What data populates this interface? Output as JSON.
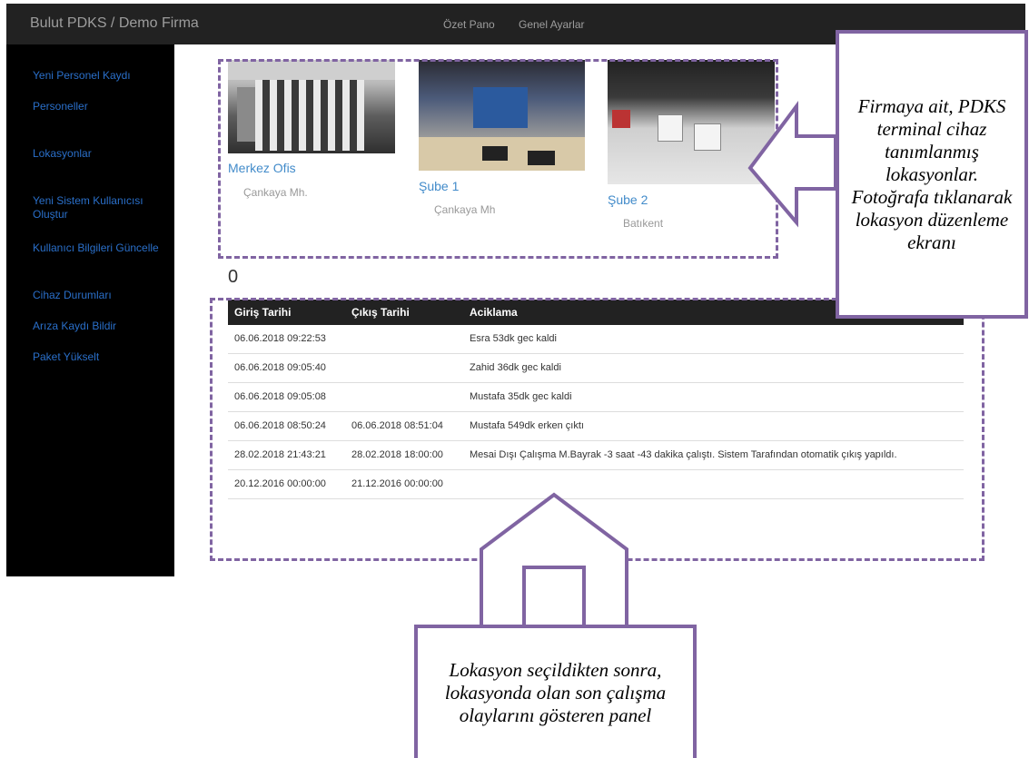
{
  "navbar": {
    "brand": "Bulut PDKS / Demo Firma",
    "links": [
      "Özet Pano",
      "Genel Ayarlar"
    ]
  },
  "sidebar": {
    "items": [
      {
        "label": "Yeni Personel Kaydı"
      },
      {
        "label": "Personeller"
      },
      {
        "label": "Lokasyonlar"
      },
      {
        "label": "Yeni Sistem Kullanıcısı Oluştur"
      },
      {
        "label": "Kullanıcı Bilgileri Güncelle"
      },
      {
        "label": "Cihaz Durumları"
      },
      {
        "label": "Arıza Kaydı Bildir"
      },
      {
        "label": "Paket Yükselt"
      }
    ]
  },
  "locations": [
    {
      "title": "Merkez Ofis",
      "address": "Çankaya Mh."
    },
    {
      "title": "Şube 1",
      "address": "Çankaya Mh"
    },
    {
      "title": "Şube 2",
      "address": "Batıkent"
    }
  ],
  "count": "0",
  "table": {
    "headers": [
      "Giriş Tarihi",
      "Çıkış Tarihi",
      "Aciklama"
    ],
    "rows": [
      [
        "06.06.2018 09:22:53",
        "",
        "Esra 53dk gec kaldi"
      ],
      [
        "06.06.2018 09:05:40",
        "",
        "Zahid 36dk gec kaldi"
      ],
      [
        "06.06.2018 09:05:08",
        "",
        "Mustafa 35dk gec kaldi"
      ],
      [
        "06.06.2018 08:50:24",
        "06.06.2018 08:51:04",
        "Mustafa 549dk erken çıktı"
      ],
      [
        "28.02.2018 21:43:21",
        "28.02.2018 18:00:00",
        "Mesai Dışı Çalışma M.Bayrak -3 saat -43 dakika çalıştı. Sistem Tarafından otomatik çıkış yapıldı."
      ],
      [
        "20.12.2016 00:00:00",
        "21.12.2016 00:00:00",
        ""
      ]
    ]
  },
  "annotations": {
    "top_right": "Firmaya ait, PDKS terminal cihaz tanımlanmış lokasyonlar. Fotoğrafa tıklanarak lokasyon düzenleme ekranı",
    "bottom": "Lokasyon seçildikten sonra, lokasyonda olan son çalışma olaylarını gösteren panel"
  },
  "colors": {
    "navbar": "#222222",
    "sidebar": "#000000",
    "sidebar_link": "#2a6fc9",
    "location_title": "#428bca",
    "annotation": "#8064a2"
  },
  "icons": [
    "location-photo"
  ]
}
